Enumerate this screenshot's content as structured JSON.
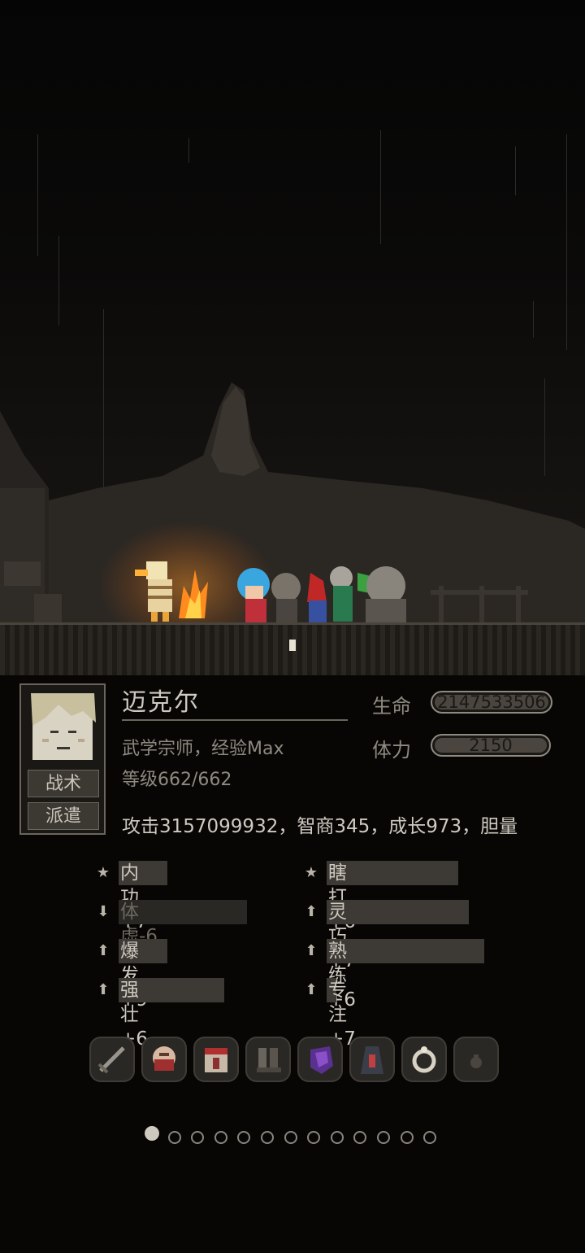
{
  "character": {
    "name": "迈克尔",
    "title": "武学宗师，经验Max",
    "level": "等级662/662",
    "stats_line": "攻击3157099932，智商345，成长973，胆量"
  },
  "portrait_buttons": {
    "tactics": "战术",
    "dispatch": "派遣"
  },
  "bars": {
    "hp_label": "生命",
    "hp_value": "2147533506",
    "stamina_label": "体力",
    "stamina_value": "2150"
  },
  "traits": [
    {
      "icon": "star-icon",
      "label": "内功+7"
    },
    {
      "icon": "star-icon",
      "label": "瞎打+6"
    },
    {
      "icon": "arrow-down-icon",
      "label": "体虚-6"
    },
    {
      "icon": "arrow-up-icon",
      "label": "灵巧+7"
    },
    {
      "icon": "arrow-up-icon",
      "label": "爆发+9"
    },
    {
      "icon": "arrow-up-icon",
      "label": "熟练+6"
    },
    {
      "icon": "arrow-up-icon",
      "label": "强壮+6"
    },
    {
      "icon": "arrow-up-icon",
      "label": "专注+7"
    }
  ],
  "equipment": [
    "sword-icon",
    "helmet-icon",
    "armor-icon",
    "boots-icon",
    "gauntlet-icon",
    "cloak-icon",
    "ring-icon",
    "empty-slot-icon"
  ],
  "pagination": {
    "total": 13,
    "active": 1
  },
  "colors": {
    "fire": "#ff9a2a",
    "panel_bg": "#070605",
    "text": "#cfcac0"
  }
}
